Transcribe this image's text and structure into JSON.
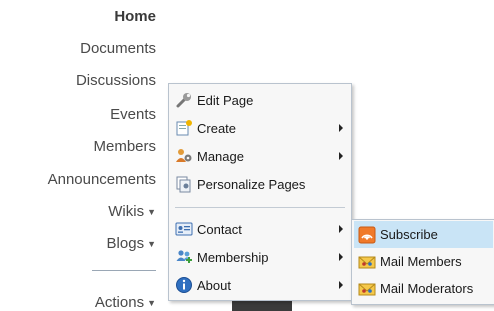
{
  "nav": {
    "items": [
      {
        "label": "Home",
        "active": true
      },
      {
        "label": "Documents"
      },
      {
        "label": "Discussions"
      },
      {
        "label": "Events"
      },
      {
        "label": "Members"
      },
      {
        "label": "Announcements"
      },
      {
        "label": "Wikis",
        "has_dropdown": true
      },
      {
        "label": "Blogs",
        "has_dropdown": true
      },
      {
        "label": "Actions",
        "has_dropdown": true
      }
    ]
  },
  "context_menu": {
    "items": [
      {
        "label": "Edit Page",
        "icon": "wrench-icon"
      },
      {
        "label": "Create",
        "icon": "create-page-icon",
        "has_submenu": true
      },
      {
        "label": "Manage",
        "icon": "manage-users-icon",
        "has_submenu": true
      },
      {
        "label": "Personalize Pages",
        "icon": "personalize-pages-icon"
      },
      {
        "label": "Contact",
        "icon": "contact-card-icon",
        "has_submenu": true
      },
      {
        "label": "Membership",
        "icon": "membership-icon",
        "has_submenu": true
      },
      {
        "label": "About",
        "icon": "info-icon",
        "has_submenu": true
      }
    ]
  },
  "submenu": {
    "items": [
      {
        "label": "Subscribe",
        "icon": "rss-feed-icon",
        "highlighted": true
      },
      {
        "label": "Mail Members",
        "icon": "envelope-icon"
      },
      {
        "label": "Mail Moderators",
        "icon": "envelope-icon"
      }
    ]
  },
  "colors": {
    "highlight": "#c9e4f6",
    "menu_border": "#b9c3ce",
    "menu_bg": "#f7f7f7",
    "nav_text": "#4a4a4a"
  }
}
